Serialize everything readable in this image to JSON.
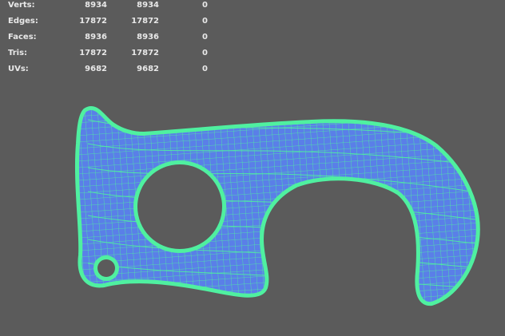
{
  "stats": {
    "rows": [
      {
        "label": "Verts:",
        "values": [
          "8934",
          "8934",
          "0"
        ]
      },
      {
        "label": "Edges:",
        "values": [
          "17872",
          "17872",
          "0"
        ]
      },
      {
        "label": "Faces:",
        "values": [
          "8936",
          "8936",
          "0"
        ]
      },
      {
        "label": "Tris:",
        "values": [
          "17872",
          "17872",
          "0"
        ]
      },
      {
        "label": "UVs:",
        "values": [
          "9682",
          "9682",
          "0"
        ]
      }
    ]
  },
  "colors": {
    "background": "#5b5b5b",
    "text": "#e8e8e8",
    "mesh_fill": "#5a7fe8",
    "wire": "#4ff0a0"
  }
}
